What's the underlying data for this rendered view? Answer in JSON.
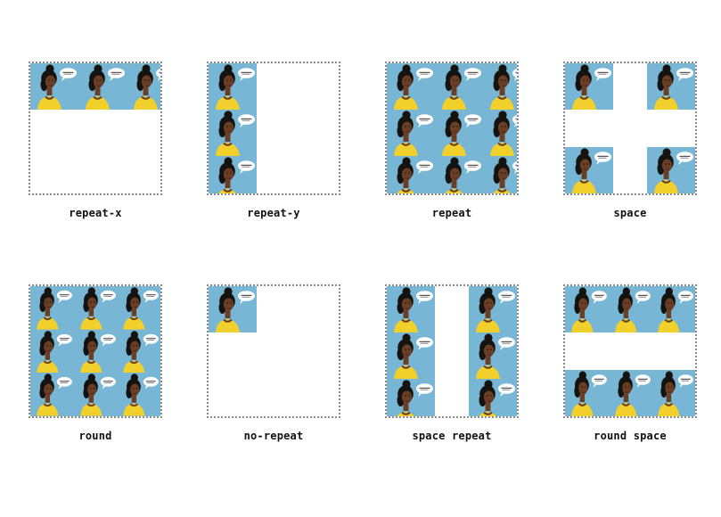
{
  "colors": {
    "tile_background": "#77b6d4",
    "hair": "#15130f",
    "skin": "#6b3f25",
    "shirt": "#f2d02c",
    "bubble": "#ffffff",
    "box_border": "#8a8a8a"
  },
  "demos": [
    {
      "id": "repeat-x",
      "label": "repeat-x"
    },
    {
      "id": "repeat-y",
      "label": "repeat-y"
    },
    {
      "id": "repeat",
      "label": "repeat"
    },
    {
      "id": "space",
      "label": "space"
    },
    {
      "id": "round",
      "label": "round"
    },
    {
      "id": "no-repeat",
      "label": "no-repeat"
    },
    {
      "id": "space-repeat",
      "label": "space repeat"
    },
    {
      "id": "round-space",
      "label": "round space"
    }
  ]
}
